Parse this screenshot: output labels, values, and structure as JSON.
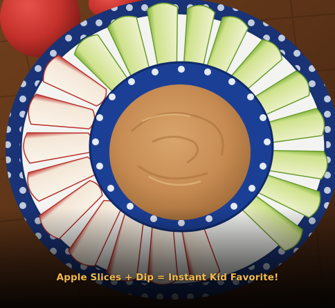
{
  "caption": {
    "text": "Apple Slices + Dip = Instant Kid Favorite!"
  },
  "colors": {
    "caption_text": "#f1b94c",
    "wood_table": "#6b3d1c",
    "plate_rim": "#173072",
    "plate_center": "#f2f3f0",
    "dip_bowl": "#1b3f97",
    "caramel_dip": "#c58a4f",
    "green_apple_skin": "#8fbe4a",
    "green_apple_flesh": "#edf1c9",
    "red_apple_skin": "#c73a32",
    "red_apple_flesh": "#f8f0e4"
  },
  "scene": {
    "subject": "platter of red and green apple slices around a bowl of caramel dip",
    "icons": [
      "plate",
      "dip-bowl",
      "red-apple",
      "green-apple-slices",
      "red-apple-slices"
    ]
  }
}
